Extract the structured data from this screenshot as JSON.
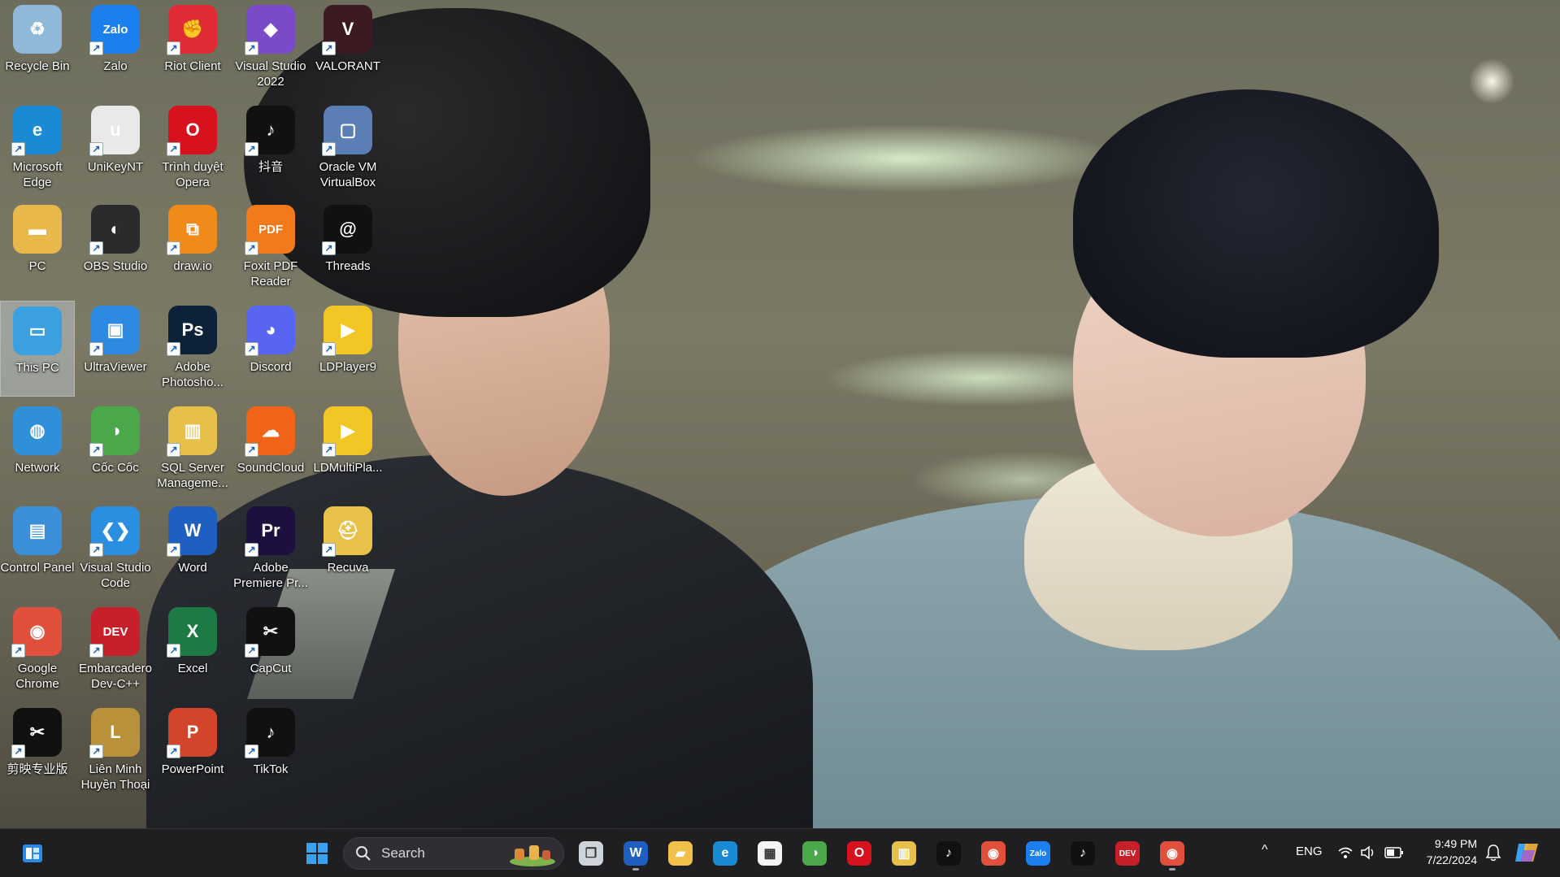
{
  "desktop": {
    "icons": [
      {
        "label": "Recycle Bin",
        "icon": "recycle-bin-icon",
        "color": "#8fb9d8",
        "glyph": "♻"
      },
      {
        "label": "Microsoft Edge",
        "icon": "edge-icon",
        "color": "#1a8ad4",
        "glyph": "e"
      },
      {
        "label": "PC",
        "icon": "folder-icon",
        "color": "#e8b84a",
        "glyph": "▬"
      },
      {
        "label": "This PC",
        "icon": "this-pc-icon",
        "color": "#3aa0e0",
        "glyph": "▭"
      },
      {
        "label": "Network",
        "icon": "network-icon",
        "color": "#2f8fd8",
        "glyph": "◍"
      },
      {
        "label": "Control Panel",
        "icon": "control-panel-icon",
        "color": "#3b8fd6",
        "glyph": "▤"
      },
      {
        "label": "Google Chrome",
        "icon": "chrome-icon",
        "color": "#e14f3d",
        "glyph": "◉"
      },
      {
        "label": "剪映专业版",
        "icon": "capcut-pro-icon",
        "color": "#111111",
        "glyph": "✂"
      },
      {
        "label": "Zalo",
        "icon": "zalo-icon",
        "color": "#1b7ff0",
        "glyph": "Zalo"
      },
      {
        "label": "UniKeyNT",
        "icon": "unikey-icon",
        "color": "#e9e9e9",
        "glyph": "u"
      },
      {
        "label": "OBS Studio",
        "icon": "obs-icon",
        "color": "#2b2b2b",
        "glyph": "◐"
      },
      {
        "label": "UltraViewer",
        "icon": "ultraviewer-icon",
        "color": "#2d8ae0",
        "glyph": "▣"
      },
      {
        "label": "Cốc Cốc",
        "icon": "coccoc-icon",
        "color": "#4aa84a",
        "glyph": "◑"
      },
      {
        "label": "Visual Studio Code",
        "icon": "vscode-icon",
        "color": "#2a8fe0",
        "glyph": "❮❯"
      },
      {
        "label": "Embarcadero Dev-C++",
        "icon": "devcpp-icon",
        "color": "#c8202a",
        "glyph": "DEV"
      },
      {
        "label": "Liên Minh Huyền Thoại",
        "icon": "league-icon",
        "color": "#b8913a",
        "glyph": "L"
      },
      {
        "label": "Riot Client",
        "icon": "riot-client-icon",
        "color": "#e02a34",
        "glyph": "✊"
      },
      {
        "label": "Trình duyệt Opera",
        "icon": "opera-icon",
        "color": "#d8111e",
        "glyph": "O"
      },
      {
        "label": "draw.io",
        "icon": "drawio-icon",
        "color": "#f08a18",
        "glyph": "⧉"
      },
      {
        "label": "Adobe Photosho...",
        "icon": "photoshop-icon",
        "color": "#0d2238",
        "glyph": "Ps"
      },
      {
        "label": "SQL Server Manageme...",
        "icon": "sql-server-icon",
        "color": "#e7c04a",
        "glyph": "▥"
      },
      {
        "label": "Word",
        "icon": "word-icon",
        "color": "#1f5fc2",
        "glyph": "W"
      },
      {
        "label": "Excel",
        "icon": "excel-icon",
        "color": "#1d7a44",
        "glyph": "X"
      },
      {
        "label": "PowerPoint",
        "icon": "powerpoint-icon",
        "color": "#d2452a",
        "glyph": "P"
      },
      {
        "label": "Visual Studio 2022",
        "icon": "visual-studio-icon",
        "color": "#7a4bc9",
        "glyph": "◆"
      },
      {
        "label": "抖音",
        "icon": "douyin-icon",
        "color": "#111111",
        "glyph": "♪"
      },
      {
        "label": "Foxit PDF Reader",
        "icon": "foxit-icon",
        "color": "#f07a1c",
        "glyph": "PDF"
      },
      {
        "label": "Discord",
        "icon": "discord-icon",
        "color": "#5865f2",
        "glyph": "◕"
      },
      {
        "label": "SoundCloud",
        "icon": "soundcloud-icon",
        "color": "#f2631a",
        "glyph": "☁"
      },
      {
        "label": "Adobe Premiere Pr...",
        "icon": "premiere-icon",
        "color": "#1d0f3e",
        "glyph": "Pr"
      },
      {
        "label": "CapCut",
        "icon": "capcut-icon",
        "color": "#111111",
        "glyph": "✂"
      },
      {
        "label": "TikTok",
        "icon": "tiktok-icon",
        "color": "#111111",
        "glyph": "♪"
      },
      {
        "label": "VALORANT",
        "icon": "valorant-icon",
        "color": "#3b1a22",
        "glyph": "V"
      },
      {
        "label": "Oracle VM VirtualBox",
        "icon": "virtualbox-icon",
        "color": "#5b7fb5",
        "glyph": "▢"
      },
      {
        "label": "Threads",
        "icon": "threads-icon",
        "color": "#111111",
        "glyph": "@"
      },
      {
        "label": "LDPlayer9",
        "icon": "ldplayer-icon",
        "color": "#f2c624",
        "glyph": "▶"
      },
      {
        "label": "LDMultiPla...",
        "icon": "ldmultiplayer-icon",
        "color": "#f2c624",
        "glyph": "▶"
      },
      {
        "label": "Recuva",
        "icon": "recuva-icon",
        "color": "#e8c24a",
        "glyph": "⛑"
      }
    ]
  },
  "taskbar": {
    "search_label": "Search",
    "apps": [
      {
        "name": "task-view-icon",
        "glyph": "❐",
        "color": "#cfd3da",
        "running": false
      },
      {
        "name": "word-taskbar-icon",
        "glyph": "W",
        "color": "#1f5fc2",
        "running": true
      },
      {
        "name": "file-explorer-icon",
        "glyph": "▰",
        "color": "#f1c04a",
        "running": false
      },
      {
        "name": "edge-taskbar-icon",
        "glyph": "e",
        "color": "#1a8ad4",
        "running": false
      },
      {
        "name": "microsoft-store-icon",
        "glyph": "▦",
        "color": "#f4f4f4",
        "running": false
      },
      {
        "name": "coccoc-taskbar-icon",
        "glyph": "◑",
        "color": "#4aa84a",
        "running": false
      },
      {
        "name": "opera-taskbar-icon",
        "glyph": "O",
        "color": "#d8111e",
        "running": false
      },
      {
        "name": "sql-server-taskbar-icon",
        "glyph": "▥",
        "color": "#e7c04a",
        "running": false
      },
      {
        "name": "douyin-taskbar-icon",
        "glyph": "♪",
        "color": "#111111",
        "running": false
      },
      {
        "name": "chrome-taskbar-icon",
        "glyph": "◉",
        "color": "#e14f3d",
        "running": false
      },
      {
        "name": "zalo-taskbar-icon",
        "glyph": "Zalo",
        "color": "#1b7ff0",
        "running": false
      },
      {
        "name": "tiktok-taskbar-icon",
        "glyph": "♪",
        "color": "#111111",
        "running": false
      },
      {
        "name": "devcpp-taskbar-icon",
        "glyph": "DEV",
        "color": "#c8202a",
        "running": false
      },
      {
        "name": "chrome-profile-taskbar-icon",
        "glyph": "◉",
        "color": "#e14f3d",
        "running": true
      }
    ],
    "tray": {
      "chevron_glyph": "^",
      "language": "ENG",
      "time": "9:49 PM",
      "date": "7/22/2024"
    }
  }
}
